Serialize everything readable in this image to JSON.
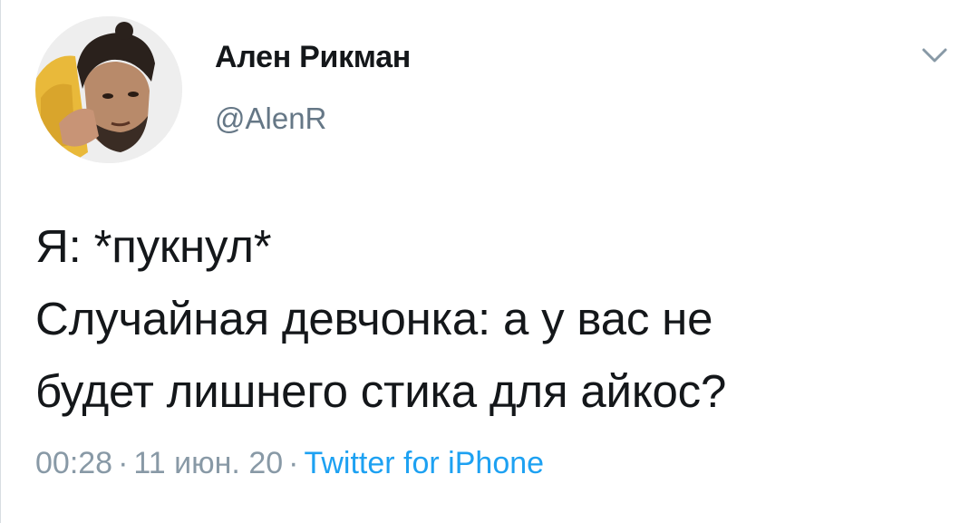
{
  "author": {
    "display_name": "Ален Рикман",
    "handle": "@AlenR",
    "avatar_icon": "profile-photo"
  },
  "tweet": {
    "lines": [
      "Я: *пукнул*",
      "Случайная девчонка: а у вас не",
      "будет лишнего стика для айкос?"
    ]
  },
  "meta": {
    "time": "00:28",
    "separator": "·",
    "date": "11 июн. 20",
    "source": "Twitter for iPhone"
  },
  "menu": {
    "icon": "chevron-down-icon"
  },
  "colors": {
    "text": "#14171a",
    "secondary": "#657786",
    "meta": "#8899a6",
    "link": "#1da1f2"
  }
}
